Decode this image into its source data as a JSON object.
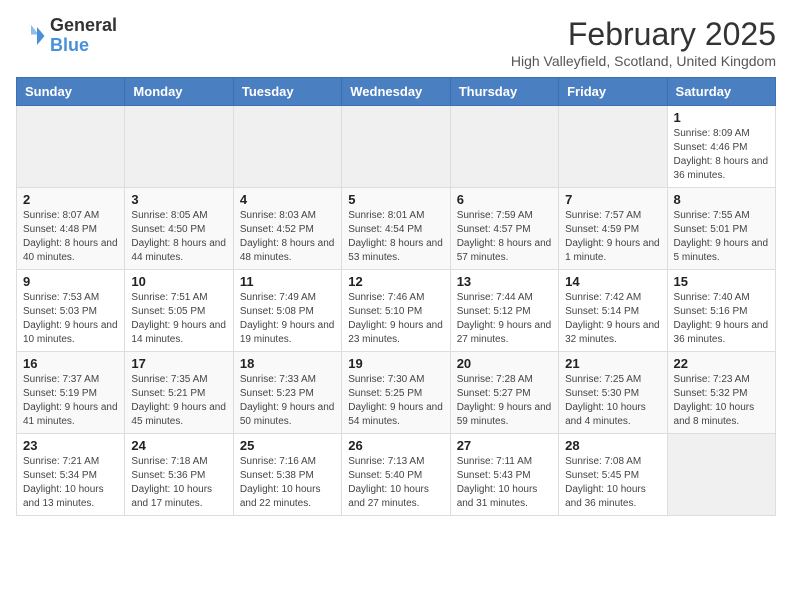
{
  "logo": {
    "general": "General",
    "blue": "Blue"
  },
  "header": {
    "month": "February 2025",
    "location": "High Valleyfield, Scotland, United Kingdom"
  },
  "weekdays": [
    "Sunday",
    "Monday",
    "Tuesday",
    "Wednesday",
    "Thursday",
    "Friday",
    "Saturday"
  ],
  "weeks": [
    [
      {
        "day": "",
        "info": ""
      },
      {
        "day": "",
        "info": ""
      },
      {
        "day": "",
        "info": ""
      },
      {
        "day": "",
        "info": ""
      },
      {
        "day": "",
        "info": ""
      },
      {
        "day": "",
        "info": ""
      },
      {
        "day": "1",
        "info": "Sunrise: 8:09 AM\nSunset: 4:46 PM\nDaylight: 8 hours and 36 minutes."
      }
    ],
    [
      {
        "day": "2",
        "info": "Sunrise: 8:07 AM\nSunset: 4:48 PM\nDaylight: 8 hours and 40 minutes."
      },
      {
        "day": "3",
        "info": "Sunrise: 8:05 AM\nSunset: 4:50 PM\nDaylight: 8 hours and 44 minutes."
      },
      {
        "day": "4",
        "info": "Sunrise: 8:03 AM\nSunset: 4:52 PM\nDaylight: 8 hours and 48 minutes."
      },
      {
        "day": "5",
        "info": "Sunrise: 8:01 AM\nSunset: 4:54 PM\nDaylight: 8 hours and 53 minutes."
      },
      {
        "day": "6",
        "info": "Sunrise: 7:59 AM\nSunset: 4:57 PM\nDaylight: 8 hours and 57 minutes."
      },
      {
        "day": "7",
        "info": "Sunrise: 7:57 AM\nSunset: 4:59 PM\nDaylight: 9 hours and 1 minute."
      },
      {
        "day": "8",
        "info": "Sunrise: 7:55 AM\nSunset: 5:01 PM\nDaylight: 9 hours and 5 minutes."
      }
    ],
    [
      {
        "day": "9",
        "info": "Sunrise: 7:53 AM\nSunset: 5:03 PM\nDaylight: 9 hours and 10 minutes."
      },
      {
        "day": "10",
        "info": "Sunrise: 7:51 AM\nSunset: 5:05 PM\nDaylight: 9 hours and 14 minutes."
      },
      {
        "day": "11",
        "info": "Sunrise: 7:49 AM\nSunset: 5:08 PM\nDaylight: 9 hours and 19 minutes."
      },
      {
        "day": "12",
        "info": "Sunrise: 7:46 AM\nSunset: 5:10 PM\nDaylight: 9 hours and 23 minutes."
      },
      {
        "day": "13",
        "info": "Sunrise: 7:44 AM\nSunset: 5:12 PM\nDaylight: 9 hours and 27 minutes."
      },
      {
        "day": "14",
        "info": "Sunrise: 7:42 AM\nSunset: 5:14 PM\nDaylight: 9 hours and 32 minutes."
      },
      {
        "day": "15",
        "info": "Sunrise: 7:40 AM\nSunset: 5:16 PM\nDaylight: 9 hours and 36 minutes."
      }
    ],
    [
      {
        "day": "16",
        "info": "Sunrise: 7:37 AM\nSunset: 5:19 PM\nDaylight: 9 hours and 41 minutes."
      },
      {
        "day": "17",
        "info": "Sunrise: 7:35 AM\nSunset: 5:21 PM\nDaylight: 9 hours and 45 minutes."
      },
      {
        "day": "18",
        "info": "Sunrise: 7:33 AM\nSunset: 5:23 PM\nDaylight: 9 hours and 50 minutes."
      },
      {
        "day": "19",
        "info": "Sunrise: 7:30 AM\nSunset: 5:25 PM\nDaylight: 9 hours and 54 minutes."
      },
      {
        "day": "20",
        "info": "Sunrise: 7:28 AM\nSunset: 5:27 PM\nDaylight: 9 hours and 59 minutes."
      },
      {
        "day": "21",
        "info": "Sunrise: 7:25 AM\nSunset: 5:30 PM\nDaylight: 10 hours and 4 minutes."
      },
      {
        "day": "22",
        "info": "Sunrise: 7:23 AM\nSunset: 5:32 PM\nDaylight: 10 hours and 8 minutes."
      }
    ],
    [
      {
        "day": "23",
        "info": "Sunrise: 7:21 AM\nSunset: 5:34 PM\nDaylight: 10 hours and 13 minutes."
      },
      {
        "day": "24",
        "info": "Sunrise: 7:18 AM\nSunset: 5:36 PM\nDaylight: 10 hours and 17 minutes."
      },
      {
        "day": "25",
        "info": "Sunrise: 7:16 AM\nSunset: 5:38 PM\nDaylight: 10 hours and 22 minutes."
      },
      {
        "day": "26",
        "info": "Sunrise: 7:13 AM\nSunset: 5:40 PM\nDaylight: 10 hours and 27 minutes."
      },
      {
        "day": "27",
        "info": "Sunrise: 7:11 AM\nSunset: 5:43 PM\nDaylight: 10 hours and 31 minutes."
      },
      {
        "day": "28",
        "info": "Sunrise: 7:08 AM\nSunset: 5:45 PM\nDaylight: 10 hours and 36 minutes."
      },
      {
        "day": "",
        "info": ""
      }
    ]
  ]
}
